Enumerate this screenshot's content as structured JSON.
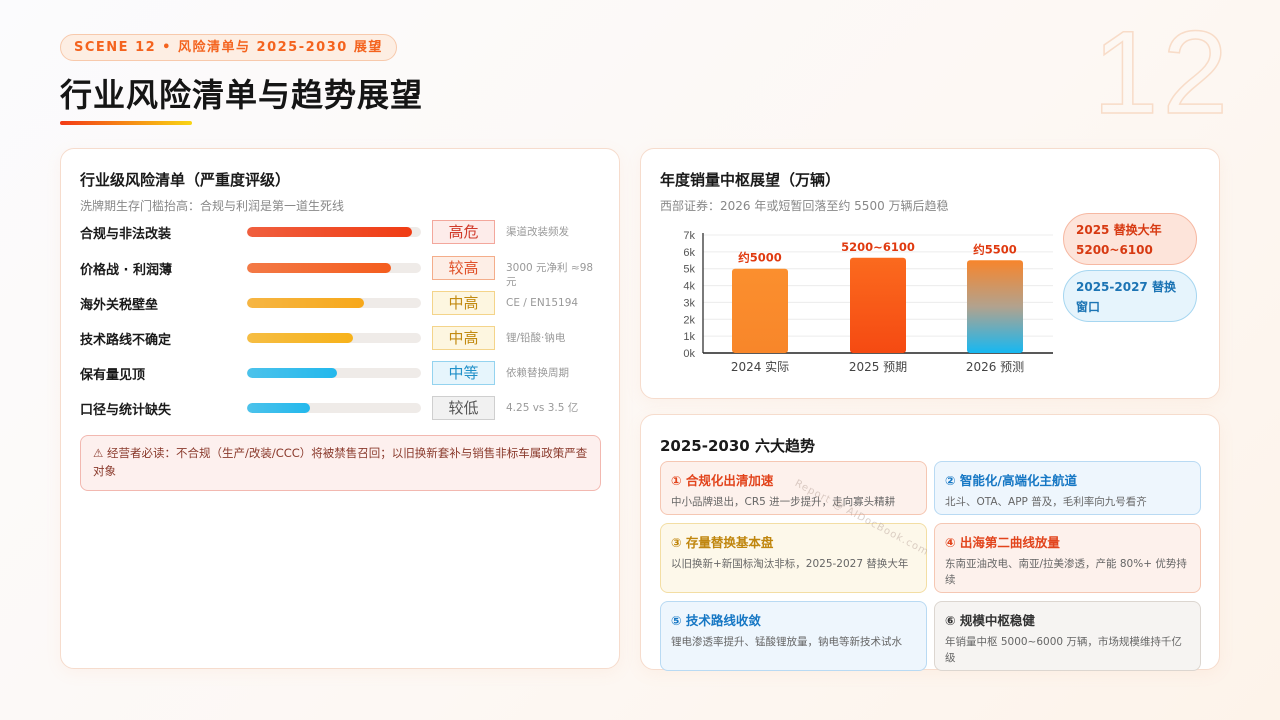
{
  "watermark_number": "12",
  "scene_tag": "SCENE 12 • 风险清单与 2025-2030 展望",
  "title": "行业风险清单与趋势展望",
  "risk": {
    "title": "行业级风险清单（严重度评级）",
    "subtitle": "洗牌期生存门槛抬高：合规与利润是第一道生死线",
    "items": [
      {
        "name": "合规与非法改装",
        "level": "高危",
        "fill_percent": 95,
        "color": "#f03c14",
        "badge_bg": "#fdecea",
        "badge_border": "#f3a79c",
        "badge_color": "#d03a2a",
        "note": "渠道改装频发"
      },
      {
        "name": "价格战 · 利润薄",
        "level": "较高",
        "fill_percent": 83,
        "color": "#f45d1e",
        "badge_bg": "#fdeee6",
        "badge_border": "#f4ad8a",
        "badge_color": "#e0522a",
        "note": "3000 元净利 ≈98元"
      },
      {
        "name": "海外关税壁垒",
        "level": "中高",
        "fill_percent": 67,
        "color": "#f7a81a",
        "badge_bg": "#fdf6e0",
        "badge_border": "#f4d48a",
        "badge_color": "#c28a10",
        "note": "CE / EN15194"
      },
      {
        "name": "技术路线不确定",
        "level": "中高",
        "fill_percent": 61,
        "color": "#f7b21a",
        "badge_bg": "#fdf6e0",
        "badge_border": "#f4d48a",
        "badge_color": "#c28a10",
        "note": "锂/铅酸·钠电"
      },
      {
        "name": "保有量见顶",
        "level": "中等",
        "fill_percent": 52,
        "color": "#23b8ec",
        "badge_bg": "#e6f5fc",
        "badge_border": "#94d3ef",
        "badge_color": "#2090c8",
        "note": "依赖替换周期"
      },
      {
        "name": "口径与统计缺失",
        "level": "较低",
        "fill_percent": 36,
        "color": "#23b8ec",
        "badge_bg": "#f1f1f1",
        "badge_border": "#cfcfcf",
        "badge_color": "#555555",
        "note": "4.25 vs 3.5 亿"
      }
    ],
    "alert": "⚠ 经营者必读：不合规（生产/改装/CCC）将被禁售召回；以旧换新套补与销售非标车属政策严查对象"
  },
  "chart": {
    "title": "年度销量中枢展望（万辆）",
    "subtitle": "西部证券：2026 年或短暂回落至约 5500 万辆后趋稳",
    "pill1": "2025 替换大年 5200~6100",
    "pill2": "2025-2027 替换窗口"
  },
  "chart_data": {
    "type": "bar",
    "categories": [
      "2024 实际",
      "2025 预期",
      "2026 预测"
    ],
    "values": [
      5000,
      5650,
      5500
    ],
    "data_labels": [
      "约5000",
      "5200~6100",
      "约5500"
    ],
    "ylim": [
      0,
      7000
    ],
    "yticks": [
      "0k",
      "1k",
      "2k",
      "3k",
      "4k",
      "5k",
      "6k",
      "7k"
    ],
    "grid": true,
    "colors": [
      "#f98a2c",
      "#f8521a",
      "gradient-orange-blue"
    ]
  },
  "trends": {
    "title": "2025-2030 六大趋势",
    "items": [
      {
        "title": "① 合规化出清加速",
        "desc": "中小品牌退出，CR5 进一步提升，走向寡头精耕",
        "bg": "#fdf1ec",
        "border": "#f5c7b3",
        "color": "#e2441c"
      },
      {
        "title": "② 智能化/高端化主航道",
        "desc": "北斗、OTA、APP 普及，毛利率向九号看齐",
        "bg": "#eef6fd",
        "border": "#b9daf3",
        "color": "#1677c4"
      },
      {
        "title": "③ 存量替换基本盘",
        "desc": "以旧换新+新国标淘汰非标，2025-2027 替换大年",
        "bg": "#fdf8ea",
        "border": "#f3dea4",
        "color": "#c0860e"
      },
      {
        "title": "④ 出海第二曲线放量",
        "desc": "东南亚油改电、南亚/拉美渗透，产能 80%+ 优势持续",
        "bg": "#fdf1ec",
        "border": "#f5c7b3",
        "color": "#e2441c"
      },
      {
        "title": "⑤ 技术路线收敛",
        "desc": "锂电渗透率提升、锰酸锂放量，钠电等新技术试水",
        "bg": "#eef6fd",
        "border": "#b9daf3",
        "color": "#1677c4"
      },
      {
        "title": "⑥ 规模中枢稳健",
        "desc": "年销量中枢 5000~6000 万辆，市场规模维持千亿级",
        "bg": "#f6f4f2",
        "border": "#dcd6d0",
        "color": "#333333"
      }
    ]
  },
  "watermark_text": "Report @ AIDocBook.com"
}
